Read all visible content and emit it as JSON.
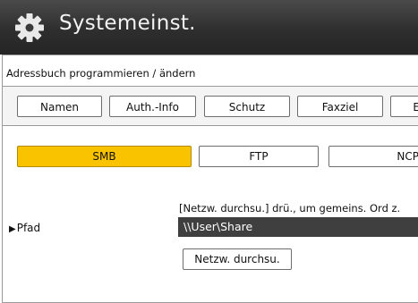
{
  "header": {
    "title": "Systemeinst.",
    "icon": "gear-icon"
  },
  "breadcrumb": "Adressbuch programmieren / ändern",
  "tabs": [
    "Namen",
    "Auth.-Info",
    "Schutz",
    "Faxziel",
    "E"
  ],
  "protocols": {
    "items": [
      "SMB",
      "FTP",
      "NCP"
    ],
    "selected": "SMB"
  },
  "path": {
    "label": "Pfad",
    "instruction": "[Netzw. durchsu.] drü., um gemeins. Ord z.",
    "value": "\\\\User\\Share",
    "browse_label": "Netzw. durchsu."
  },
  "colors": {
    "selected": "#f9c300",
    "header_bg": "#333333",
    "field_bg": "#3f3f3f"
  }
}
